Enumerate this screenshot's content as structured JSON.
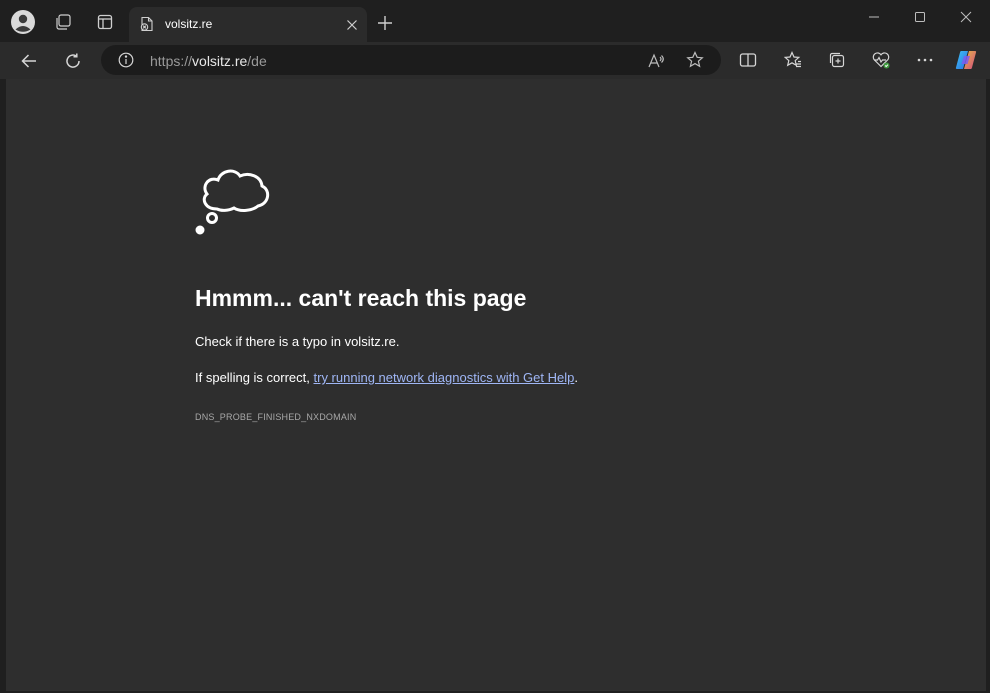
{
  "tab": {
    "title": "volsitz.re"
  },
  "address_bar": {
    "scheme": "https://",
    "host": "volsitz.re",
    "path": "/de"
  },
  "error_page": {
    "title": "Hmmm... can't reach this page",
    "line1": "Check if there is a typo in volsitz.re.",
    "line2_prefix": "If spelling is correct, ",
    "line2_link": "try running network diagnostics with Get Help",
    "line2_suffix": ".",
    "error_code": "DNS_PROBE_FINISHED_NXDOMAIN"
  },
  "icons": {
    "profile": "profile-avatar-icon",
    "workspaces": "workspaces-icon",
    "tab_actions": "vertical-tabs-icon",
    "tab_favicon": "page-error-icon",
    "tab_close": "close-icon",
    "new_tab": "plus-icon",
    "minimize": "minimize-icon",
    "maximize": "maximize-icon",
    "close_window": "close-icon",
    "back": "back-arrow-icon",
    "refresh": "refresh-icon",
    "site_info": "info-icon",
    "read_aloud": "read-aloud-icon",
    "add_favorite": "star-icon",
    "split_screen": "split-screen-icon",
    "favorites": "favorites-icon",
    "collections": "collections-icon",
    "browser_essentials": "heart-pulse-icon",
    "more": "more-dots-icon",
    "copilot": "copilot-icon",
    "error_illustration": "thought-cloud-icon"
  },
  "colors": {
    "chrome_bg": "#1f1f1f",
    "toolbar_bg": "#2b2b2b",
    "page_bg": "#2e2e2e",
    "link": "#9fb6f5"
  }
}
